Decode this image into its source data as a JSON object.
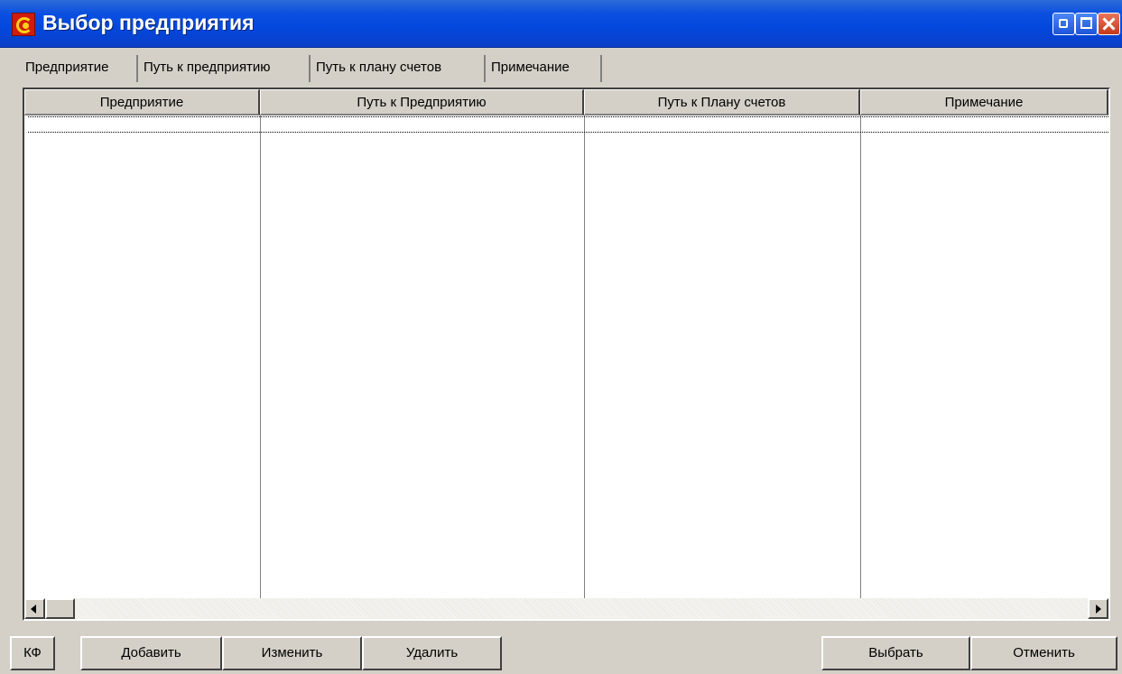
{
  "window": {
    "title": "Выбор предприятия"
  },
  "tabs": [
    {
      "label": "Предприятие",
      "active": true
    },
    {
      "label": "Путь к предприятию",
      "active": false
    },
    {
      "label": "Путь к плану счетов",
      "active": false
    },
    {
      "label": "Примечание",
      "active": false
    }
  ],
  "table": {
    "columns": [
      "Предприятие",
      "Путь к Предприятию",
      "Путь к Плану счетов",
      "Примечание"
    ],
    "rows": []
  },
  "buttons": {
    "kf": "КФ",
    "add": "Добавить",
    "edit": "Изменить",
    "delete": "Удалить",
    "select": "Выбрать",
    "cancel": "Отменить"
  },
  "colors": {
    "titlebar": "#0a4fe0",
    "window_bg": "#d4d0c8",
    "close_button": "#c7381a"
  },
  "icons": [
    "app-icon",
    "minimize-icon",
    "maximize-icon",
    "close-icon",
    "scroll-left-icon",
    "scroll-right-icon"
  ]
}
